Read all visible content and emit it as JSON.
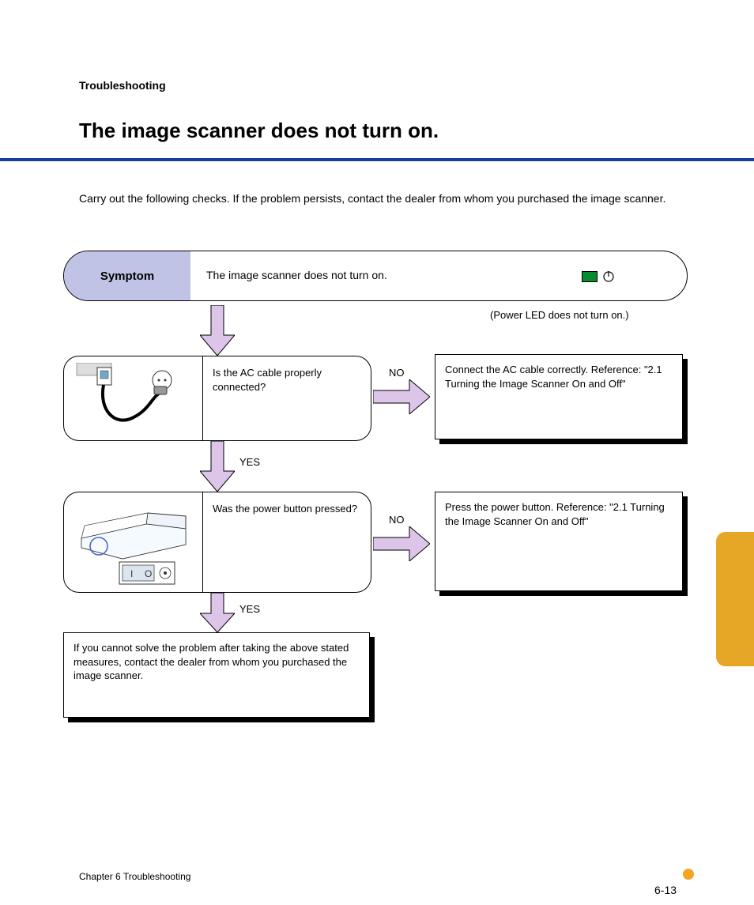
{
  "header": {
    "category": "Troubleshooting",
    "title": "The image scanner does not turn on."
  },
  "intro": "Carry out the following checks. If the problem persists, contact the dealer from whom you purchased the image scanner.",
  "pill": {
    "label": "Symptom",
    "text": "The image scanner does not turn on.",
    "led_label": "(Power LED does not turn on.)"
  },
  "step1": {
    "question": "Is the AC cable properly connected?",
    "yes_label": "YES",
    "no_label": "NO",
    "result_no": "Connect the AC cable correctly. Reference: \"2.1 Turning the Image Scanner On and Off\""
  },
  "step2": {
    "question": "Was the power button pressed?",
    "yes_label": "YES",
    "no_label": "NO",
    "result_no": "Press the power button. Reference: \"2.1 Turning the Image Scanner On and Off\""
  },
  "final": {
    "text": "If you cannot solve the problem after taking the above stated measures, contact the dealer from whom you purchased the image scanner."
  },
  "footer": {
    "chapter": "Chapter  6  Troubleshooting",
    "page": "6-13"
  }
}
